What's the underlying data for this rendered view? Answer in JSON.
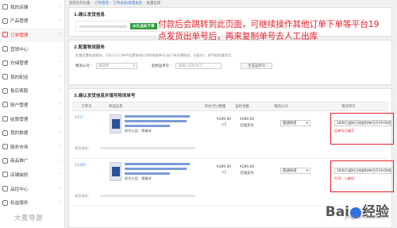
{
  "sidebar": {
    "items": [
      {
        "label": "我的店铺",
        "icon": "store-icon",
        "active": false
      },
      {
        "label": "产品管理",
        "icon": "product-icon",
        "active": false
      },
      {
        "label": "订单管理",
        "icon": "order-icon",
        "active": true
      },
      {
        "label": "营销中心",
        "icon": "marketing-icon",
        "active": false
      },
      {
        "label": "仓储管理",
        "icon": "warehouse-icon",
        "active": false
      },
      {
        "label": "我的配送",
        "icon": "delivery-icon",
        "active": false
      },
      {
        "label": "售后客服",
        "icon": "service-icon",
        "active": false
      },
      {
        "label": "账户管理",
        "icon": "account-icon",
        "active": false
      },
      {
        "label": "结算管理",
        "icon": "settlement-icon",
        "active": false
      },
      {
        "label": "我的数据",
        "icon": "data-icon",
        "active": false
      },
      {
        "label": "服务市场",
        "icon": "market-icon",
        "active": false
      },
      {
        "label": "商品推广",
        "icon": "promotion-icon",
        "active": false
      },
      {
        "label": "店铺装修",
        "icon": "decorate-icon",
        "active": false
      },
      {
        "label": "品控中心",
        "icon": "quality-icon",
        "active": false
      },
      {
        "label": "权益服务",
        "icon": "benefit-icon",
        "active": false
      }
    ],
    "chevron": "›"
  },
  "breadcrumb": {
    "home": "您所在的位置",
    "sep": "›",
    "level1": "订单管理",
    "level2": "订单发货/批量发货",
    "current": "批量出库"
  },
  "section1": {
    "title": "1.确认发货信息",
    "tag": "从礼品站下单"
  },
  "section2": {
    "title": "2.配置物流服务",
    "tip": "批量设置物流服务，可在以下订单中设置物流公司和物流单号(若订单无需物流，可留空)，将不能批量发货。",
    "company_label": "物流公司：",
    "company_placeholder": "请选择",
    "number_label": "起始运单号：",
    "number_placeholder": "请输入起始单号",
    "generate_button": "生成运单号"
  },
  "section3": {
    "title": "3.确认发货信息并填写物流单号",
    "headers": [
      "订单号",
      "商品信息",
      "单价(元)/数量",
      "运杆金额",
      "物流公司",
      "物流单号"
    ],
    "orders": [
      {
        "order_no": "1117",
        "meta": "颜色分类：雾霾绿",
        "price": "¥289.00",
        "qty": "×1",
        "ship_amount": "¥289.00",
        "pay_status": "在线支付",
        "courier": "圆通快递",
        "tracking": "1600已超时已经超时单号开19:00前出",
        "tip": "运单号已填写",
        "receiver": "收货地址："
      },
      {
        "order_no": "11165",
        "meta": "颜色分类：雾霾绿",
        "price": "¥289.00",
        "qty": "×1",
        "ship_amount": "¥289.00",
        "pay_status": "在线支付",
        "courier": "圆通快递",
        "tracking": "1600已超时已经超时单号开19:00前出",
        "tip": "行号：二维码",
        "receiver": "收货地址："
      }
    ]
  },
  "callout": "付款后会跳转到此页面，可继续操作其他订单下单等平台19点发货出单号后，再来复制单号去人工出库",
  "watermark": "大麦导游",
  "baidu": {
    "logo_left": "Bai",
    "logo_right": "经验",
    "sub": "jingyan.baidu.com"
  }
}
